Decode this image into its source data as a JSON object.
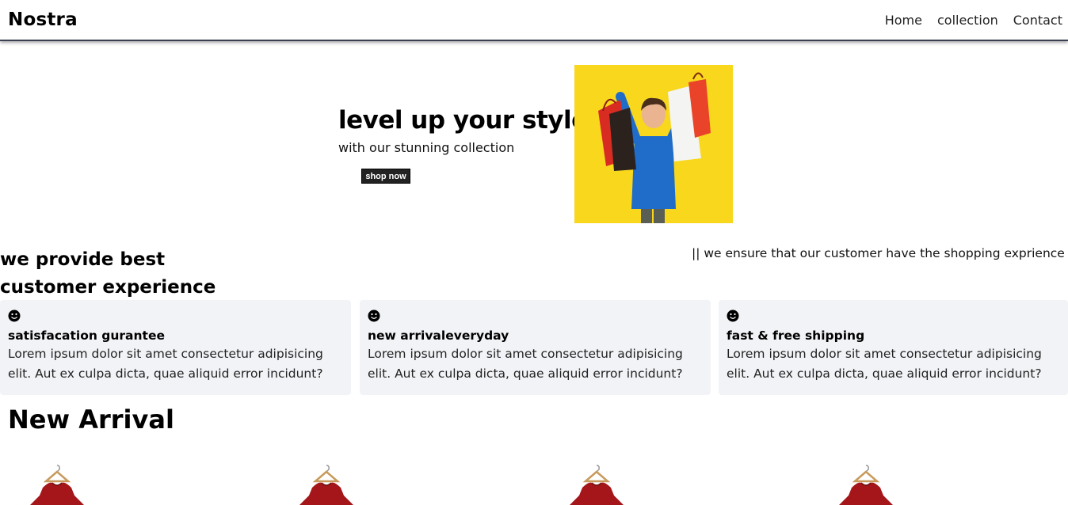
{
  "nav": {
    "logo": "Nostra",
    "links": [
      "Home",
      "collection",
      "Contact"
    ]
  },
  "hero": {
    "title": "level up your style",
    "subtitle": "with our stunning collection",
    "button_label": "shop now"
  },
  "experience": {
    "title_line1": "we provide best",
    "title_line2": "customer experience",
    "marquee": "|| we ensure that our customer have the shopping exprience"
  },
  "features": [
    {
      "icon": "smile-icon",
      "title": "satisfacation gurantee",
      "text": "Lorem ipsum dolor sit amet consectetur adipisicing elit. Aut ex culpa dicta, quae aliquid error incidunt?"
    },
    {
      "icon": "smile-icon",
      "title": "new arrivaleveryday",
      "text": "Lorem ipsum dolor sit amet consectetur adipisicing elit. Aut ex culpa dicta, quae aliquid error incidunt?"
    },
    {
      "icon": "smile-icon",
      "title": "fast & free shipping",
      "text": "Lorem ipsum dolor sit amet consectetur adipisicing elit. Aut ex culpa dicta, quae aliquid error incidunt?"
    }
  ],
  "arrivals": {
    "title": "New Arrival"
  },
  "colors": {
    "hero_image_bg": "#f8d71d",
    "card_bg": "#f2f3f6",
    "button_bg": "#222222",
    "product_shirt": "#a4161a"
  }
}
